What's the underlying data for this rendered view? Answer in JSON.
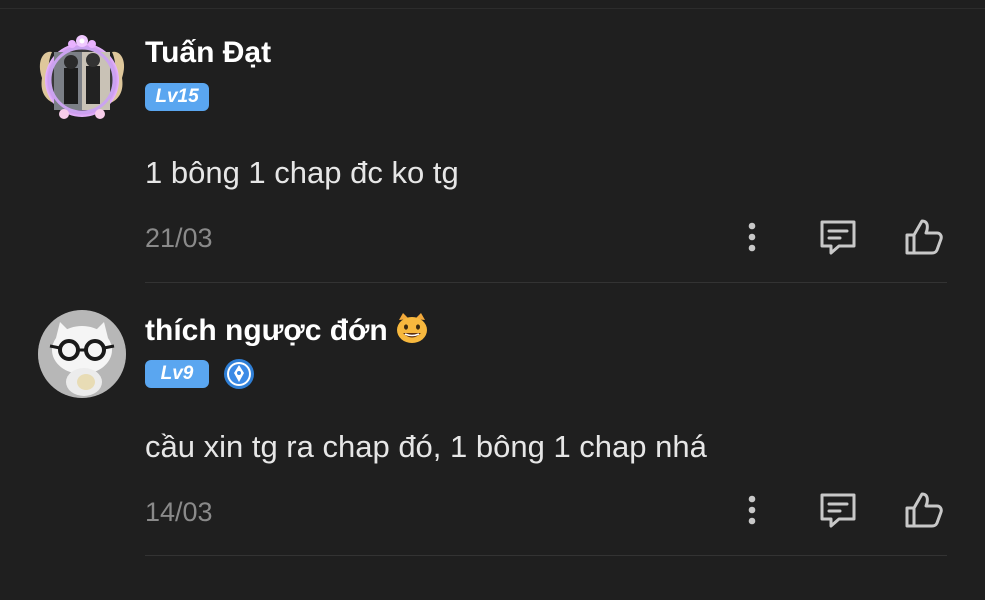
{
  "comments": [
    {
      "username": "Tuấn Đạt",
      "level": "Lv15",
      "text": "1 bông 1 chap đc ko tg",
      "date": "21/03",
      "avatar_icon": "avatar-with-flower-frame",
      "has_medal": false
    },
    {
      "username": "thích ngược đớn",
      "username_emoji": "grinning-cat-emoji",
      "level": "Lv9",
      "text": "cầu xin tg ra chap đó, 1 bông 1 chap nhá",
      "date": "14/03",
      "avatar_icon": "cat-with-glasses-avatar",
      "has_medal": true,
      "medal_icon": "blue-pen-medal-icon"
    }
  ],
  "actions": {
    "more_icon": "more-vertical-icon",
    "reply_icon": "comment-reply-icon",
    "like_icon": "thumbs-up-icon"
  },
  "colors": {
    "background": "#1f1f1f",
    "level_badge": "#5aa6f0",
    "text": "#e6e6e6",
    "muted": "#8a8a8a"
  }
}
